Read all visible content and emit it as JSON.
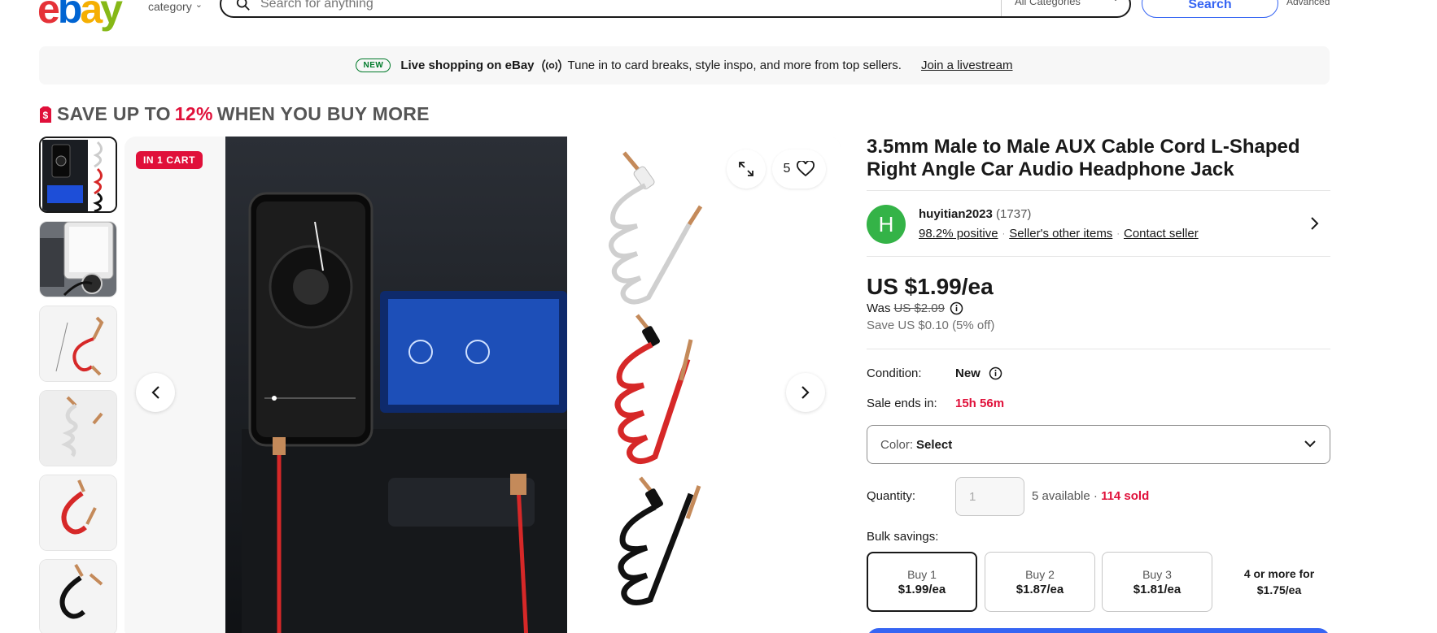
{
  "header": {
    "logo": {
      "e": "e",
      "b": "b",
      "a": "a",
      "y": "y"
    },
    "category_label": "category",
    "search_placeholder": "Search for anything",
    "category_select": "All Categories",
    "search_button": "Search",
    "advanced_link": "Advanced"
  },
  "banner": {
    "new_tag": "NEW",
    "live_text": "Live shopping on eBay",
    "tune_text": "Tune in to card breaks, style inspo, and more from top sellers.",
    "join_link": "Join a livestream"
  },
  "promo": {
    "prefix": "SAVE UP TO",
    "percent": "12%",
    "suffix": "WHEN YOU BUY MORE"
  },
  "gallery": {
    "in_cart_badge": "IN 1 CART",
    "watch_count": "5",
    "thumbnails": [
      "collage",
      "phone-mount",
      "red-cable",
      "white-cable",
      "red-coil",
      "black-coil"
    ]
  },
  "listing": {
    "title": "3.5mm Male to Male AUX Cable Cord L-Shaped Right Angle Car Audio Headphone Jack",
    "seller": {
      "initial": "H",
      "name": "huyitian2023",
      "feedback_count": "(1737)",
      "positive": "98.2% positive",
      "other_items": "Seller's other items",
      "contact": "Contact seller"
    },
    "price": "US $1.99/ea",
    "was_label": "Was",
    "was_price": "US $2.09",
    "savings": "Save US $0.10 (5% off)",
    "condition_label": "Condition:",
    "condition_value": "New",
    "sale_label": "Sale ends in:",
    "sale_value": "15h 56m",
    "color_key": "Color:",
    "color_value": "Select",
    "quantity_label": "Quantity:",
    "quantity_value": "1",
    "available": "5 available",
    "sold": "114 sold",
    "bulk_label": "Bulk savings:",
    "bulk": [
      {
        "qty": "Buy 1",
        "price": "$1.99/ea"
      },
      {
        "qty": "Buy 2",
        "price": "$1.87/ea"
      },
      {
        "qty": "Buy 3",
        "price": "$1.81/ea"
      }
    ],
    "bulk_more": "4 or more for $1.75/ea"
  },
  "colors": {
    "accent": "#3665f3",
    "sale_red": "#e0103a",
    "new_green": "#007a2a"
  }
}
